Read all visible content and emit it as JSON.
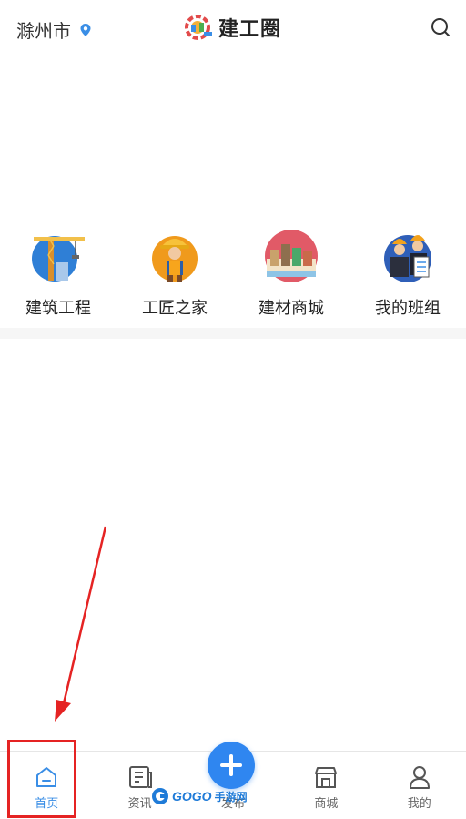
{
  "header": {
    "city": "滁州市",
    "app_name": "建工圈"
  },
  "categories": [
    {
      "label": "建筑工程",
      "icon": "crane-icon"
    },
    {
      "label": "工匠之家",
      "icon": "worker-icon"
    },
    {
      "label": "建材商城",
      "icon": "buildings-icon"
    },
    {
      "label": "我的班组",
      "icon": "team-icon"
    }
  ],
  "tabbar": {
    "home": "首页",
    "news": "资讯",
    "publish": "发布",
    "mall": "商城",
    "mine": "我的"
  },
  "watermark": {
    "brand": "GOGO",
    "cn": "手游网"
  },
  "colors": {
    "accent": "#3a8ee6",
    "publish": "#2f86f0",
    "annotation": "#e52323"
  }
}
